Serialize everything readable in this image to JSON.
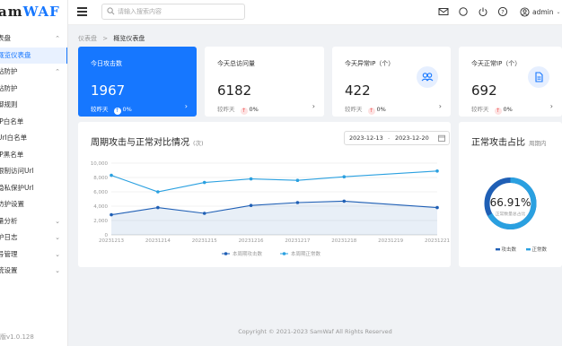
{
  "app": {
    "logo_prefix": "am",
    "logo_accent": "WAF",
    "version": "l版v1.0.128"
  },
  "sidebar": {
    "items": [
      {
        "label": "表盘",
        "chevron": "⌃",
        "active": false
      },
      {
        "label": "概览仪表盘",
        "chevron": "",
        "active": true
      },
      {
        "label": "站防护",
        "chevron": "⌃",
        "active": false
      },
      {
        "label": "站防护",
        "chevron": "",
        "active": false
      },
      {
        "label": "御规则",
        "chevron": "",
        "active": false
      },
      {
        "label": "IP白名单",
        "chevron": "",
        "active": false
      },
      {
        "label": "Url白名单",
        "chevron": "",
        "active": false
      },
      {
        "label": "IP黑名单",
        "chevron": "",
        "active": false
      },
      {
        "label": "限制访问Url",
        "chevron": "",
        "active": false
      },
      {
        "label": "隐私保护Url",
        "chevron": "",
        "active": false
      },
      {
        "label": "防护设置",
        "chevron": "",
        "active": false
      },
      {
        "label": "量分析",
        "chevron": "⌄",
        "active": false
      },
      {
        "label": "护日志",
        "chevron": "⌄",
        "active": false
      },
      {
        "label": "号管理",
        "chevron": "⌄",
        "active": false
      },
      {
        "label": "统设置",
        "chevron": "⌄",
        "active": false
      }
    ]
  },
  "header": {
    "search_placeholder": "请输入搜索内容",
    "user": "admin",
    "icons": [
      "mail-icon",
      "circle-icon",
      "power-icon",
      "help-icon",
      "user-icon"
    ]
  },
  "breadcrumb": {
    "root": "仪表盘",
    "separator": ">",
    "current": "概览仪表盘"
  },
  "stats": [
    {
      "title": "今日攻击数",
      "value": "1967",
      "compare": "较昨天",
      "change": "0%",
      "primary": true,
      "icon": ""
    },
    {
      "title": "今天总访问量",
      "value": "6182",
      "compare": "较昨天",
      "change": "0%",
      "primary": false,
      "icon": ""
    },
    {
      "title": "今天异常IP（个）",
      "value": "422",
      "compare": "较昨天",
      "change": "0%",
      "primary": false,
      "icon": "users-icon"
    },
    {
      "title": "今天正常IP（个）",
      "value": "692",
      "compare": "较昨天",
      "change": "0%",
      "primary": false,
      "icon": "document-icon"
    }
  ],
  "trend": {
    "title": "周期攻击与正常对比情况",
    "subtitle": "(次)",
    "date_start": "2023-12-13",
    "date_sep": "-",
    "date_end": "2023-12-20"
  },
  "ratio": {
    "title": "正常攻击占比",
    "subtitle": "周期内",
    "percent": "66.91%",
    "percent_value": 66.91,
    "caption": "正常数量总占比",
    "legend": [
      {
        "name": "攻击数",
        "color": "#1f5fb5"
      },
      {
        "name": "正常数",
        "color": "#2aa0e0"
      }
    ]
  },
  "chart_data": {
    "type": "line",
    "x": [
      "20231213",
      "20231214",
      "20231215",
      "20231216",
      "20231217",
      "20231218",
      "20231219",
      "20231221"
    ],
    "ylim": [
      0,
      10000
    ],
    "yticks": [
      "10,000",
      "8,000",
      "6,000",
      "4,000",
      "2,000",
      "0"
    ],
    "grid": true,
    "legend_position": "bottom",
    "series": [
      {
        "name": "本周期攻击数",
        "color": "#1f5fb5",
        "values": [
          2800,
          3800,
          3000,
          4100,
          4500,
          4700,
          3800
        ]
      },
      {
        "name": "本周期正常数",
        "color": "#2aa0e0",
        "values": [
          8300,
          6000,
          7300,
          7800,
          7600,
          8100,
          8900
        ]
      }
    ],
    "point_x_index": [
      0,
      1,
      2,
      3,
      4,
      5,
      7
    ]
  },
  "footer": {
    "copyright": "Copyright © 2021-2023 SamWaf All Rights Reserved"
  }
}
